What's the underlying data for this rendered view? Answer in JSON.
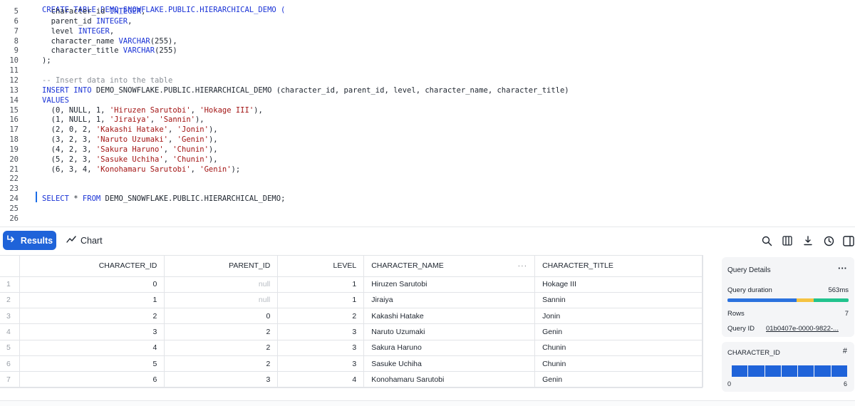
{
  "editor": {
    "first_line_partial": "CREATE TABLE DEMO_SNOWFLAKE.PUBLIC.HIERARCHICAL_DEMO (",
    "lines": [
      {
        "n": "5",
        "segs": [
          [
            "tx",
            "  character_id "
          ],
          [
            "ty",
            "INTEGER"
          ],
          [
            "tx",
            ","
          ]
        ]
      },
      {
        "n": "6",
        "segs": [
          [
            "tx",
            "  parent_id "
          ],
          [
            "ty",
            "INTEGER"
          ],
          [
            "tx",
            ","
          ]
        ]
      },
      {
        "n": "7",
        "segs": [
          [
            "tx",
            "  level "
          ],
          [
            "ty",
            "INTEGER"
          ],
          [
            "tx",
            ","
          ]
        ]
      },
      {
        "n": "8",
        "segs": [
          [
            "tx",
            "  character_name "
          ],
          [
            "ty",
            "VARCHAR"
          ],
          [
            "tx",
            "(255),"
          ]
        ]
      },
      {
        "n": "9",
        "segs": [
          [
            "tx",
            "  character_title "
          ],
          [
            "ty",
            "VARCHAR"
          ],
          [
            "tx",
            "(255)"
          ]
        ]
      },
      {
        "n": "10",
        "segs": [
          [
            "tx",
            ");"
          ]
        ]
      },
      {
        "n": "11",
        "segs": []
      },
      {
        "n": "12",
        "segs": [
          [
            "cm",
            "-- Insert data into the table"
          ]
        ]
      },
      {
        "n": "13",
        "segs": [
          [
            "kw",
            "INSERT INTO "
          ],
          [
            "tx",
            "DEMO_SNOWFLAKE.PUBLIC.HIERARCHICAL_DEMO (character_id, parent_id, level, character_name, character_title)"
          ]
        ]
      },
      {
        "n": "14",
        "segs": [
          [
            "kw",
            "VALUES"
          ]
        ]
      },
      {
        "n": "15",
        "segs": [
          [
            "tx",
            "  (0, NULL, 1, "
          ],
          [
            "str",
            "'Hiruzen Sarutobi'"
          ],
          [
            "tx",
            ", "
          ],
          [
            "str",
            "'Hokage III'"
          ],
          [
            "tx",
            "),"
          ]
        ]
      },
      {
        "n": "16",
        "segs": [
          [
            "tx",
            "  (1, NULL, 1, "
          ],
          [
            "str",
            "'Jiraiya'"
          ],
          [
            "tx",
            ", "
          ],
          [
            "str",
            "'Sannin'"
          ],
          [
            "tx",
            "),"
          ]
        ]
      },
      {
        "n": "17",
        "segs": [
          [
            "tx",
            "  (2, 0, 2, "
          ],
          [
            "str",
            "'Kakashi Hatake'"
          ],
          [
            "tx",
            ", "
          ],
          [
            "str",
            "'Jonin'"
          ],
          [
            "tx",
            "),"
          ]
        ]
      },
      {
        "n": "18",
        "segs": [
          [
            "tx",
            "  (3, 2, 3, "
          ],
          [
            "str",
            "'Naruto Uzumaki'"
          ],
          [
            "tx",
            ", "
          ],
          [
            "str",
            "'Genin'"
          ],
          [
            "tx",
            "),"
          ]
        ]
      },
      {
        "n": "19",
        "segs": [
          [
            "tx",
            "  (4, 2, 3, "
          ],
          [
            "str",
            "'Sakura Haruno'"
          ],
          [
            "tx",
            ", "
          ],
          [
            "str",
            "'Chunin'"
          ],
          [
            "tx",
            "),"
          ]
        ]
      },
      {
        "n": "20",
        "segs": [
          [
            "tx",
            "  (5, 2, 3, "
          ],
          [
            "str",
            "'Sasuke Uchiha'"
          ],
          [
            "tx",
            ", "
          ],
          [
            "str",
            "'Chunin'"
          ],
          [
            "tx",
            "),"
          ]
        ]
      },
      {
        "n": "21",
        "segs": [
          [
            "tx",
            "  (6, 3, 4, "
          ],
          [
            "str",
            "'Konohamaru Sarutobi'"
          ],
          [
            "tx",
            ", "
          ],
          [
            "str",
            "'Genin'"
          ],
          [
            "tx",
            ");"
          ]
        ]
      },
      {
        "n": "22",
        "segs": []
      },
      {
        "n": "23",
        "segs": []
      },
      {
        "n": "24",
        "segs": [
          [
            "kw",
            "SELECT "
          ],
          [
            "tx",
            "* "
          ],
          [
            "kw",
            "FROM "
          ],
          [
            "tx",
            "DEMO_SNOWFLAKE.PUBLIC.HIERARCHICAL_DEMO;"
          ]
        ]
      },
      {
        "n": "25",
        "segs": []
      },
      {
        "n": "26",
        "segs": []
      }
    ]
  },
  "toolbar": {
    "results_label": "Results",
    "chart_label": "Chart",
    "icons": [
      "search-icon",
      "columns-icon",
      "download-icon",
      "history-icon",
      "panel-toggle-icon"
    ]
  },
  "grid": {
    "columns": [
      "CHARACTER_ID",
      "PARENT_ID",
      "LEVEL",
      "CHARACTER_NAME",
      "CHARACTER_TITLE"
    ],
    "rows": [
      {
        "rn": "1",
        "id": "0",
        "parent": "null",
        "level": "1",
        "name": "Hiruzen Sarutobi",
        "title": "Hokage III"
      },
      {
        "rn": "2",
        "id": "1",
        "parent": "null",
        "level": "1",
        "name": "Jiraiya",
        "title": "Sannin"
      },
      {
        "rn": "3",
        "id": "2",
        "parent": "0",
        "level": "2",
        "name": "Kakashi Hatake",
        "title": "Jonin"
      },
      {
        "rn": "4",
        "id": "3",
        "parent": "2",
        "level": "3",
        "name": "Naruto Uzumaki",
        "title": "Genin"
      },
      {
        "rn": "5",
        "id": "4",
        "parent": "2",
        "level": "3",
        "name": "Sakura Haruno",
        "title": "Chunin"
      },
      {
        "rn": "6",
        "id": "5",
        "parent": "2",
        "level": "3",
        "name": "Sasuke Uchiha",
        "title": "Chunin"
      },
      {
        "rn": "7",
        "id": "6",
        "parent": "3",
        "level": "4",
        "name": "Konohamaru Sarutobi",
        "title": "Genin"
      }
    ]
  },
  "query_details": {
    "title": "Query Details",
    "more": "···",
    "duration_label": "Query duration",
    "duration_value": "563ms",
    "duration_segments": [
      {
        "fraction": 0.57,
        "color": "#2b72de"
      },
      {
        "fraction": 0.14,
        "color": "#f5c342"
      },
      {
        "fraction": 0.29,
        "color": "#22c38e"
      }
    ],
    "rows_label": "Rows",
    "rows_value": "7",
    "query_id_label": "Query ID",
    "query_id_value": "01b0407e-0000-9822-..."
  },
  "column_stats": {
    "title": "CHARACTER_ID",
    "type_glyph": "#",
    "bins": 7,
    "min_label": "0",
    "max_label": "6",
    "bar_color": "#1f63d9"
  }
}
